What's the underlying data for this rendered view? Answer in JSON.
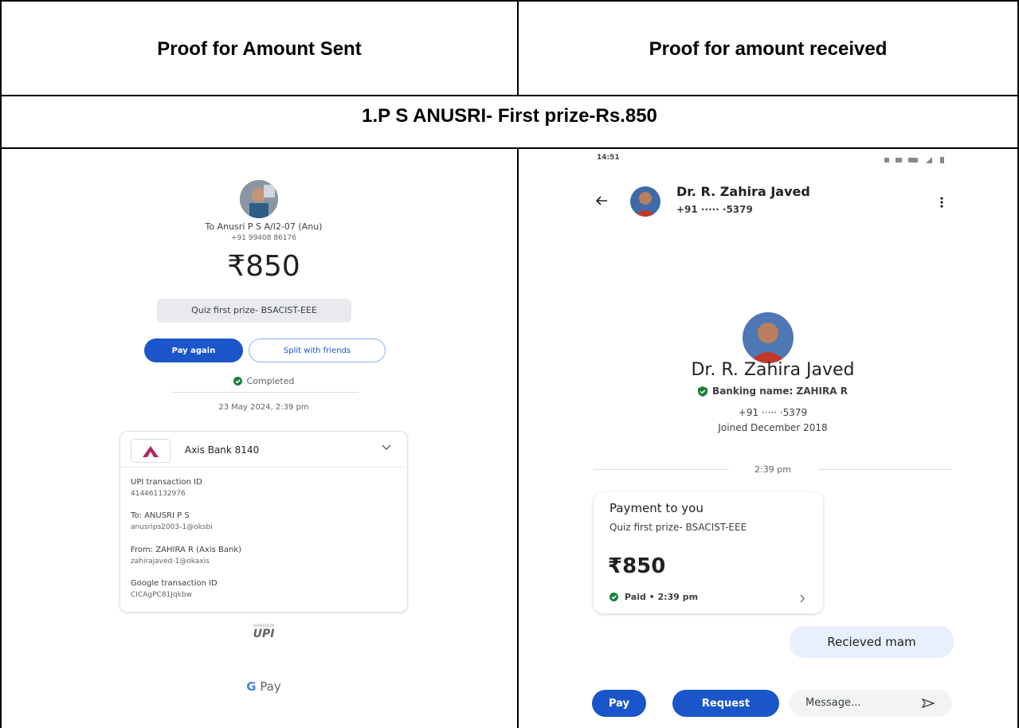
{
  "table": {
    "col1_header": "Proof for Amount Sent",
    "col2_header": "Proof for amount received",
    "row_title": "1.P S ANUSRI- First prize-Rs.850"
  },
  "sent": {
    "recipient": "To Anusri P S A/I2-07 (Anu)",
    "phone": "+91 99408 86176",
    "amount": "₹850",
    "note": "Quiz first prize- BSACIST-EEE",
    "pay_again": "Pay again",
    "split": "Split with friends",
    "status": "Completed",
    "datetime": "23 May 2024, 2:39 pm",
    "bank": "Axis Bank 8140",
    "upi_label": "UPI transaction ID",
    "upi_id": "414461132976",
    "to_label": "To: ANUSRI  P S",
    "to_vpa": "anusrips2003-1@oksbi",
    "from_label": "From: ZAHIRA R (Axis Bank)",
    "from_vpa": "zahirajaved-1@okaxis",
    "google_label": "Google transaction ID",
    "google_id": "CICAgPC81Jqkbw",
    "powered_by": "POWERED BY",
    "upi_logo": "UPI",
    "gpay_g": "G",
    "gpay": "Pay"
  },
  "received": {
    "time": "14:51",
    "contact_name": "Dr. R. Zahira Javed",
    "contact_phone": "+91 ····· ·5379",
    "profile_name": "Dr. R. Zahira Javed",
    "banking_name": "Banking name: ZAHIRA R",
    "profile_phone": "+91 ····· ·5379",
    "joined": "Joined December 2018",
    "chat_time": "2:39 pm",
    "card_title": "Payment to you",
    "card_note": "Quiz first prize- BSACIST-EEE",
    "card_amount": "₹850",
    "card_status": "Paid • 2:39 pm",
    "reply": "Recieved mam",
    "pay_btn": "Pay",
    "request_btn": "Request",
    "message_placeholder": "Message..."
  },
  "colors": {
    "gpay_blue": "#1a56c9",
    "completed_green": "#188038",
    "axis_red": "#ae275f"
  }
}
